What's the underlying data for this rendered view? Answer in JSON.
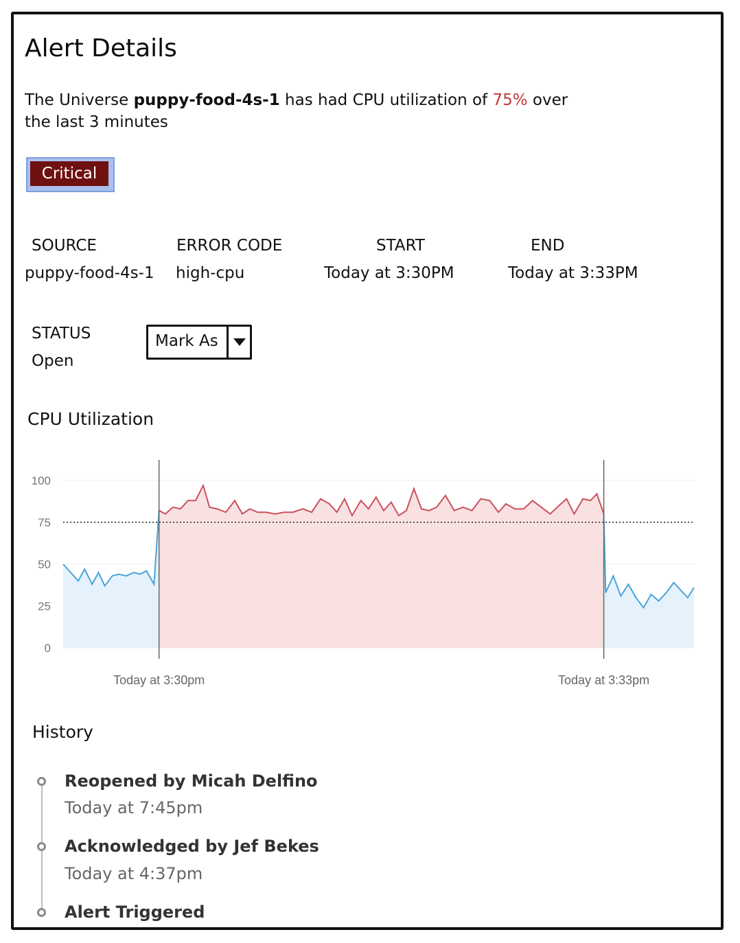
{
  "page": {
    "title": "Alert Details",
    "description": {
      "prefix": "The Universe ",
      "universe": "puppy-food-4s-1",
      "middle": " has had CPU utilization of ",
      "percent": "75%",
      "suffix": " over the last 3 minutes"
    },
    "severity": {
      "label": "Critical",
      "color": "#6f1111",
      "highlight": "#a9c0ee"
    }
  },
  "details": {
    "source": {
      "label": "SOURCE",
      "value": "puppy-food-4s-1"
    },
    "error_code": {
      "label": "ERROR CODE",
      "value": "high-cpu"
    },
    "start": {
      "label": "START",
      "value": "Today at 3:30PM"
    },
    "end": {
      "label": "END",
      "value": "Today at 3:33PM"
    },
    "status": {
      "label": "STATUS",
      "value": "Open"
    },
    "mark_as": {
      "label": "Mark As",
      "icon": "caret-down-icon"
    }
  },
  "cpu_section": {
    "title": "CPU Utilization"
  },
  "chart_data": {
    "type": "area",
    "title": "",
    "xlabel": "",
    "ylabel": "",
    "ylim": [
      0,
      100
    ],
    "y_ticks": [
      "100",
      "75",
      "50",
      "25",
      "0"
    ],
    "threshold": 75,
    "x_range": [
      0,
      100
    ],
    "markers": [
      {
        "x": 15.2,
        "label": "Today at 3:30pm"
      },
      {
        "x": 85.7,
        "label": "Today at 3:33pm"
      }
    ],
    "colors": {
      "normal_line": "#4aa3d9",
      "normal_fill": "#e6f2fb",
      "alert_line": "#c9505a",
      "alert_fill": "#f9e1e2",
      "threshold": "#555555",
      "grid": "#eeeeee"
    },
    "series": [
      {
        "points": [
          [
            0,
            50
          ],
          [
            1.2,
            45
          ],
          [
            2.4,
            40
          ],
          [
            3.4,
            47
          ],
          [
            4.6,
            38
          ],
          [
            5.6,
            45
          ],
          [
            6.6,
            37
          ],
          [
            7.8,
            43
          ],
          [
            8.8,
            44
          ],
          [
            10,
            43
          ],
          [
            11.2,
            45
          ],
          [
            12.2,
            44
          ],
          [
            13.2,
            46
          ],
          [
            14.4,
            38
          ],
          [
            15.2,
            82
          ]
        ]
      },
      {
        "points": [
          [
            15.2,
            82
          ],
          [
            16.2,
            80
          ],
          [
            17.4,
            84
          ],
          [
            18.6,
            83
          ],
          [
            19.8,
            88
          ],
          [
            21,
            88
          ],
          [
            22.2,
            97
          ],
          [
            23.2,
            84
          ],
          [
            24.4,
            83
          ],
          [
            25.8,
            81
          ],
          [
            27.2,
            88
          ],
          [
            28.4,
            80
          ],
          [
            29.6,
            83
          ],
          [
            30.8,
            81
          ],
          [
            32.2,
            81
          ],
          [
            33.6,
            80
          ],
          [
            35,
            81
          ],
          [
            36.4,
            81
          ],
          [
            38,
            83
          ],
          [
            39.4,
            81
          ],
          [
            40.8,
            89
          ],
          [
            42.2,
            86
          ],
          [
            43.4,
            81
          ],
          [
            44.6,
            89
          ],
          [
            45.8,
            79
          ],
          [
            47.2,
            88
          ],
          [
            48.4,
            83
          ],
          [
            49.6,
            90
          ],
          [
            50.8,
            82
          ],
          [
            52,
            87
          ],
          [
            53.2,
            79
          ],
          [
            54.4,
            82
          ],
          [
            55.6,
            95
          ],
          [
            56.8,
            83
          ],
          [
            58,
            82
          ],
          [
            59.2,
            84
          ],
          [
            60.6,
            91
          ],
          [
            62,
            82
          ],
          [
            63.4,
            84
          ],
          [
            64.8,
            82
          ],
          [
            66.2,
            89
          ],
          [
            67.6,
            88
          ],
          [
            69,
            81
          ],
          [
            70.2,
            86
          ],
          [
            71.6,
            83
          ],
          [
            73,
            83
          ],
          [
            74.4,
            88
          ],
          [
            75.8,
            84
          ],
          [
            77.2,
            80
          ],
          [
            78.6,
            85
          ],
          [
            79.8,
            89
          ],
          [
            81,
            80
          ],
          [
            82.4,
            89
          ],
          [
            83.6,
            88
          ],
          [
            84.6,
            92
          ],
          [
            85.7,
            80
          ]
        ]
      },
      {
        "points": [
          [
            85.7,
            80
          ],
          [
            86,
            33
          ],
          [
            87.2,
            43
          ],
          [
            88.4,
            31
          ],
          [
            89.6,
            38
          ],
          [
            90.8,
            30
          ],
          [
            92,
            24
          ],
          [
            93.2,
            32
          ],
          [
            94.4,
            28
          ],
          [
            95.6,
            33
          ],
          [
            96.8,
            39
          ],
          [
            98,
            34
          ],
          [
            99,
            30
          ],
          [
            100,
            36
          ]
        ]
      }
    ]
  },
  "history": {
    "title": "History",
    "items": [
      {
        "title": "Reopened by Micah Delfino",
        "time": "Today at 7:45pm"
      },
      {
        "title": "Acknowledged by Jef Bekes",
        "time": "Today at 4:37pm"
      },
      {
        "title": "Alert Triggered",
        "time": ""
      }
    ]
  }
}
